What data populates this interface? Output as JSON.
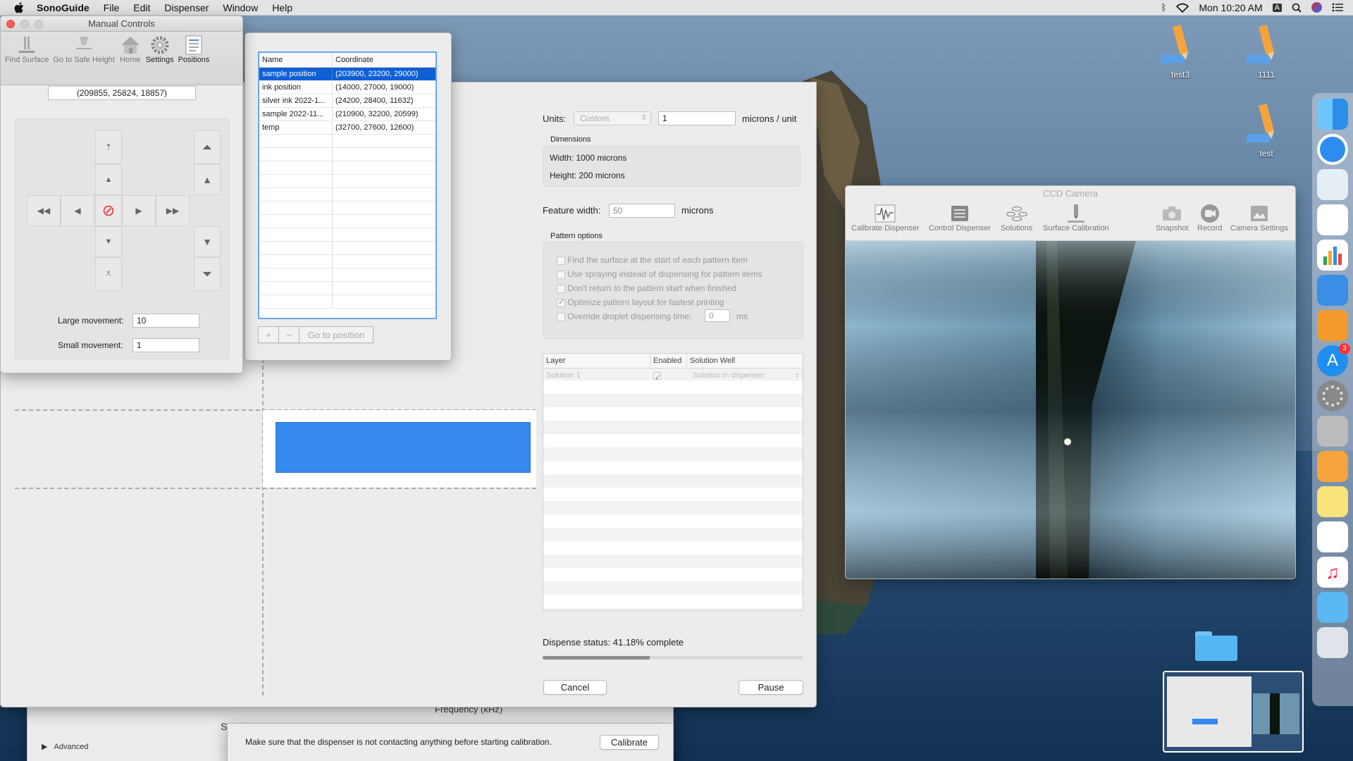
{
  "menubar": {
    "app": "SonoGuide",
    "menus": [
      "File",
      "Edit",
      "Dispenser",
      "Window",
      "Help"
    ],
    "clock": "Mon 10:20 AM",
    "input_source": "A"
  },
  "manual_controls": {
    "title": "Manual Controls",
    "toolbar": [
      "Find Surface",
      "Go to Safe Height",
      "Home",
      "Settings",
      "Positions"
    ],
    "position": "(209855, 25824, 18857)",
    "large_movement_label": "Large movement:",
    "large_movement_value": "10",
    "small_movement_label": "Small movement:",
    "small_movement_value": "1"
  },
  "positions": {
    "headers": [
      "Name",
      "Coordinate"
    ],
    "rows": [
      {
        "name": "sample position",
        "coord": "(203900, 23200, 29000)",
        "selected": true
      },
      {
        "name": "ink position",
        "coord": "(14000, 27000, 19000)"
      },
      {
        "name": "silver ink 2022-1...",
        "coord": "(24200, 28400, 11632)"
      },
      {
        "name": "sample 2022-11...",
        "coord": "(210900, 32200, 20599)"
      },
      {
        "name": "temp",
        "coord": "(32700, 27600, 12600)"
      }
    ],
    "add_label": "+",
    "remove_label": "−",
    "goto_label": "Go to position"
  },
  "pattern": {
    "units_label": "Units:",
    "units_value": "Custom",
    "units_scale": "1",
    "units_suffix": "microns / unit",
    "dimensions_title": "Dimensions",
    "width_text": "Width: 1000 microns",
    "height_text": "Height: 200 microns",
    "feature_width_label": "Feature width:",
    "feature_width_value": "50",
    "feature_width_unit": "microns",
    "pattern_options_title": "Pattern options",
    "options": [
      {
        "label": "Find the surface at the start of each pattern item",
        "checked": false
      },
      {
        "label": "Use spraying instead of dispensing for pattern items",
        "checked": false
      },
      {
        "label": "Don't return to the pattern start when finished",
        "checked": false
      },
      {
        "label": "Optimize pattern layout for fastest printing",
        "checked": true
      },
      {
        "label": "Override droplet dispensing time:",
        "checked": false
      }
    ],
    "override_value": "0",
    "override_unit": "ms",
    "layer_headers": [
      "Layer",
      "Enabled",
      "Solution Well"
    ],
    "layer_rows": [
      {
        "layer": "Solution 1",
        "enabled": true,
        "well": "Solution in dispenser"
      }
    ],
    "status_text": "Dispense status: 41.18% complete",
    "progress": 0.4118,
    "cancel_label": "Cancel",
    "pause_label": "Pause"
  },
  "calibration": {
    "freq_label": "Frequency (kHz)",
    "advanced_label": "Advanced",
    "hint_text": "Make sure that the dispenser is not contacting anything before starting calibration.",
    "calibrate_label": "Calibrate",
    "partial_letter": "S"
  },
  "camera": {
    "title": "CCD Camera",
    "toolbar_left": [
      "Calibrate Dispenser",
      "Control Dispenser",
      "Solutions",
      "Surface Calibration"
    ],
    "toolbar_right": [
      "Snapshot",
      "Record",
      "Camera Settings"
    ]
  },
  "desktop": {
    "icons": [
      "test3",
      "1111",
      "test"
    ]
  },
  "dock": {
    "appstore_badge": "3"
  },
  "colors": {
    "accent": "#2f7bea",
    "pattern_fill": "#3589f0",
    "selection": "#0f5fd6"
  }
}
